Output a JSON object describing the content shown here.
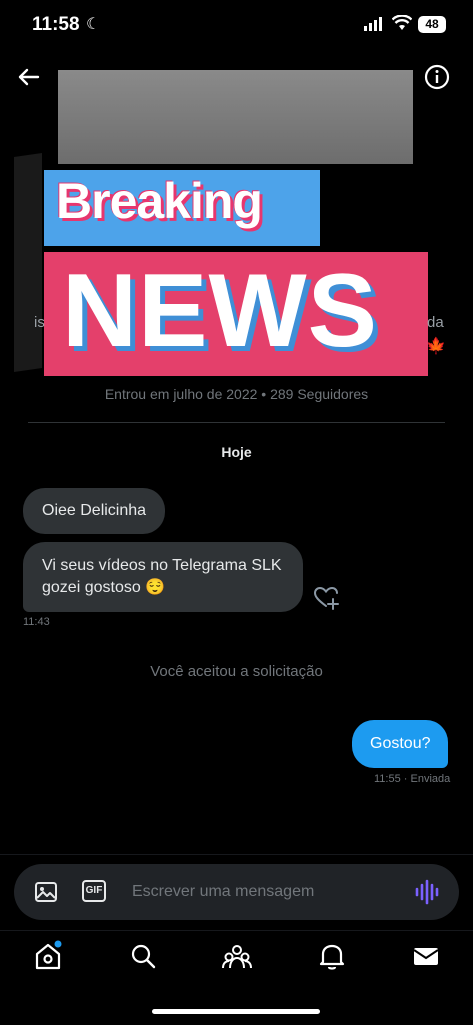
{
  "status_bar": {
    "time": "11:58",
    "battery": "48"
  },
  "banner": {
    "line1": "Breaking",
    "line2": "NEWS"
  },
  "profile": {
    "left_fragment": "is",
    "right_fragment": "da",
    "right_emoji": "🍁",
    "joined_text": "Entrou em julho de 2022 • 289 Seguidores"
  },
  "chat": {
    "day_label": "Hoje",
    "incoming": [
      {
        "text": "Oiee Delicinha"
      },
      {
        "text": "Vi seus vídeos no Telegrama SLK gozei gostoso 😌"
      }
    ],
    "incoming_time": "11:43",
    "system_message": "Você aceitou a solicitação",
    "outgoing": {
      "text": "Gostou?",
      "meta": "11:55 · Enviada"
    }
  },
  "composer": {
    "placeholder": "Escrever uma mensagem",
    "gif_label": "GIF"
  },
  "tabs": [
    "home",
    "search",
    "communities",
    "notifications",
    "messages"
  ],
  "colors": {
    "accent": "#1d9bf0",
    "bubble_in": "#2f3336",
    "breaking_blue": "#4da3ea",
    "news_red": "#e4406b",
    "voice": "#7b61ff"
  }
}
